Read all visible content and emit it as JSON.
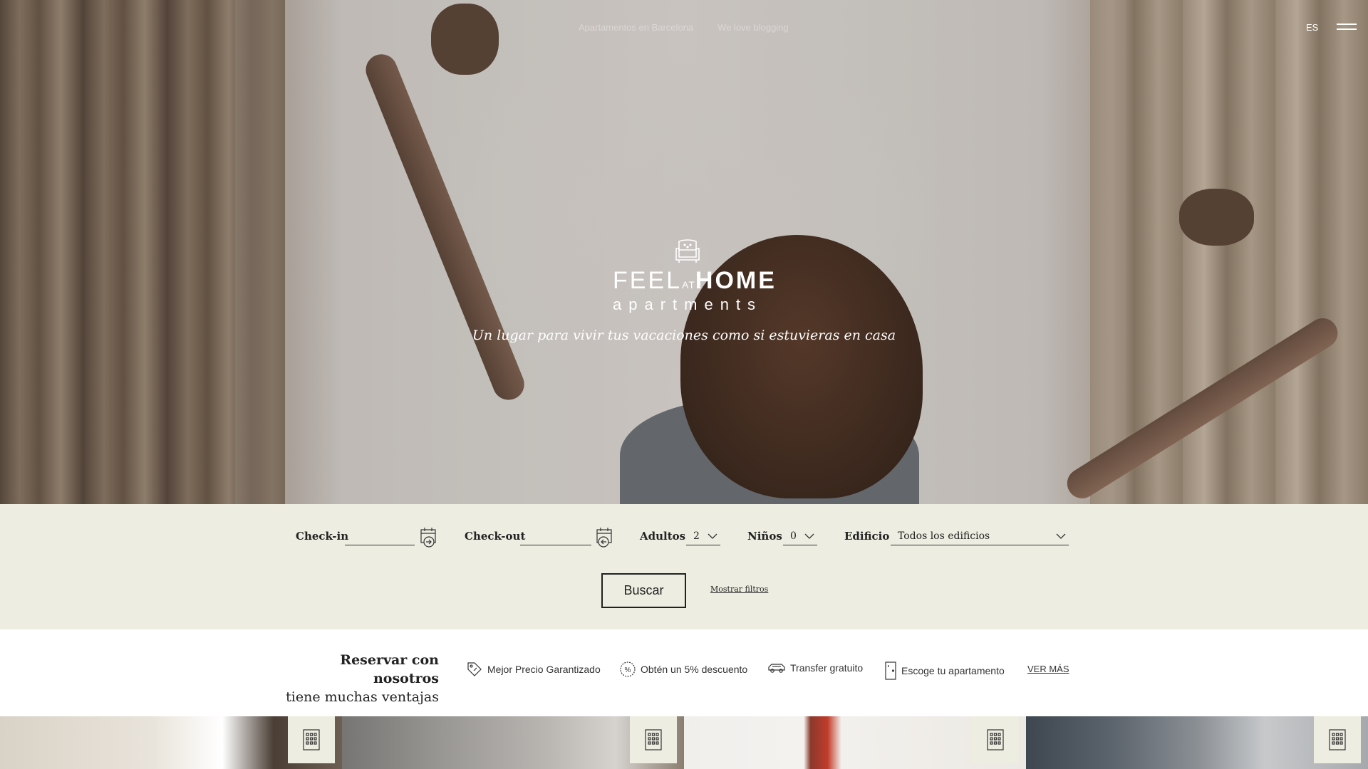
{
  "nav": {
    "links": [
      "Apartamentos en Barcelona",
      "We love blogging"
    ],
    "language": "ES"
  },
  "brand": {
    "logo_word_1": "FEEL",
    "logo_word_2": "AT",
    "logo_word_3": "HOME",
    "logo_sub": "apartments",
    "tagline": "Un lugar para vivir tus vacaciones como si estuvieras en casa"
  },
  "search": {
    "checkin_label": "Check-in",
    "checkin_value": "",
    "checkout_label": "Check-out",
    "checkout_value": "",
    "adults_label": "Adultos",
    "adults_value": "2",
    "children_label": "Niños",
    "children_value": "0",
    "building_label": "Edificio",
    "building_value": "Todos los edificios",
    "search_button": "Buscar",
    "filters_link": "Mostrar filtros"
  },
  "advantages": {
    "title_line1": "Reservar con nosotros",
    "title_line2": "tiene muchas ventajas",
    "items": [
      {
        "icon": "price-tag-icon",
        "label": "Mejor Precio Garantizado"
      },
      {
        "icon": "discount-icon",
        "label": "Obtén un 5% descuento"
      },
      {
        "icon": "car-icon",
        "label": "Transfer gratuito"
      },
      {
        "icon": "door-icon",
        "label": "Escoge tu apartamento"
      }
    ],
    "more_link": "VER MÁS"
  },
  "cards": [
    {
      "icon": "building-icon"
    },
    {
      "icon": "building-icon"
    },
    {
      "icon": "building-icon"
    },
    {
      "icon": "building-icon"
    }
  ],
  "colors": {
    "search_bg": "#eeede1",
    "text_dark": "#222222",
    "white": "#ffffff"
  }
}
